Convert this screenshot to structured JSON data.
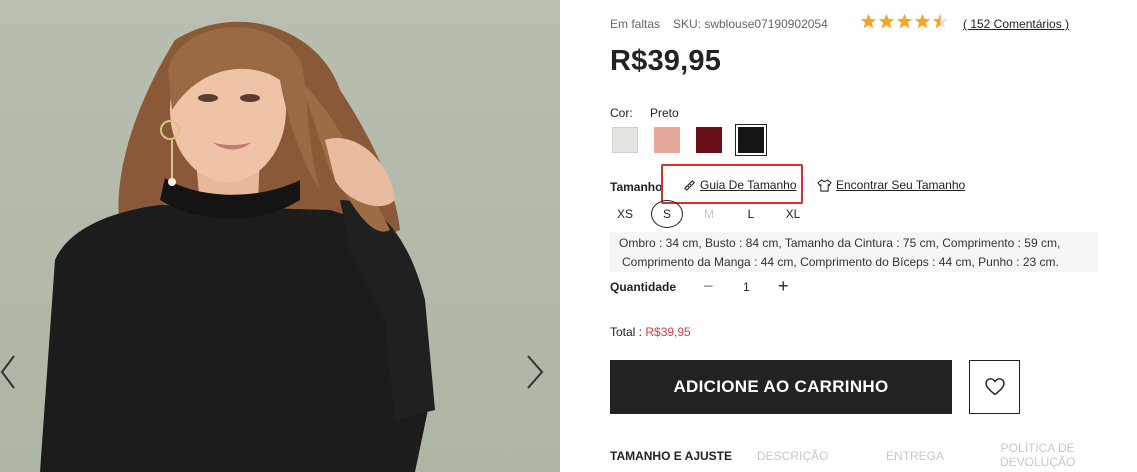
{
  "product": {
    "stock_status": "Em faltas",
    "sku": "SKU: swblouse07190902054",
    "rating": 4.5,
    "reviews_link": "( 152 Comentários )",
    "price": "R$39,95"
  },
  "color": {
    "label": "Cor:",
    "selected": "Preto",
    "swatches": [
      {
        "name": "light-gray",
        "hex": "#e5e4e1"
      },
      {
        "name": "pink",
        "hex": "#e8a99d"
      },
      {
        "name": "burgundy",
        "hex": "#6b0f19"
      },
      {
        "name": "black",
        "hex": "#161616"
      }
    ]
  },
  "size": {
    "label": "Tamanho",
    "guide_link": "Guia De Tamanho",
    "find_link": "Encontrar Seu Tamanho",
    "options": [
      "XS",
      "S",
      "M",
      "L",
      "XL"
    ],
    "selected": "S",
    "unavailable": [
      "M"
    ],
    "measurements": [
      "Ombro : 34 cm,  Busto : 84 cm,  Tamanho da Cintura : 75 cm,  Comprimento : 59 cm,",
      "Comprimento da Manga : 44 cm,  Comprimento do Bíceps : 44 cm,  Punho : 23 cm."
    ]
  },
  "quantity": {
    "label": "Quantidade",
    "minus": "−",
    "value": "1",
    "plus": "+"
  },
  "total": {
    "label": "Total : ",
    "value": "R$39,95"
  },
  "actions": {
    "add_to_cart": "ADICIONE AO CARRINHO"
  },
  "tabs": [
    "TAMANHO E AJUSTE",
    "DESCRIÇÃO",
    "ENTREGA",
    "POLÍTICA DE",
    "DEVOLUÇÃO"
  ],
  "colors": {
    "accent_red": "#d0342c",
    "price_red": "#cc4444",
    "dark": "#222222"
  },
  "icons": {
    "star": "star-icon",
    "ruler": "ruler-icon",
    "shirt": "tshirt-icon",
    "heart": "heart-icon"
  }
}
